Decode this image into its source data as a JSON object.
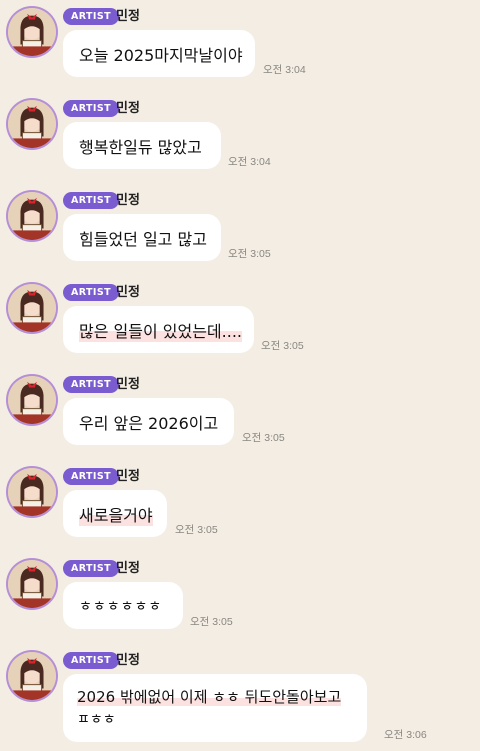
{
  "chat": {
    "badge": "ARTIST",
    "sender": "민정",
    "messages": [
      {
        "text": "오늘 2025마지막날이야",
        "time": "오전 3:04"
      },
      {
        "text": "행복한일듀 많았고",
        "time": "오전 3:04"
      },
      {
        "text": "힘들었던 일고 많고",
        "time": "오전 3:05"
      },
      {
        "text": "많은 일들이 있었는데....",
        "time": "오전 3:05"
      },
      {
        "text": "우리 앞은 2026이고",
        "time": "오전 3:05"
      },
      {
        "text": "새로을거야",
        "time": "오전 3:05"
      },
      {
        "text": "ㅎㅎㅎㅎㅎㅎ",
        "time": "오전 3:05"
      },
      {
        "text_line1": "2026 밖에없어 이제 ㅎㅎ 뒤도안돌아보고",
        "text_line2": "ㅍㅎㅎ",
        "time": "오전 3:06"
      }
    ]
  },
  "icons": {
    "avatar": "profile-photo-icon"
  },
  "colors": {
    "background": "#f3ede4",
    "badge": "#7b5bd0",
    "bubble": "#ffffff",
    "highlight": "#fbe1e0"
  }
}
